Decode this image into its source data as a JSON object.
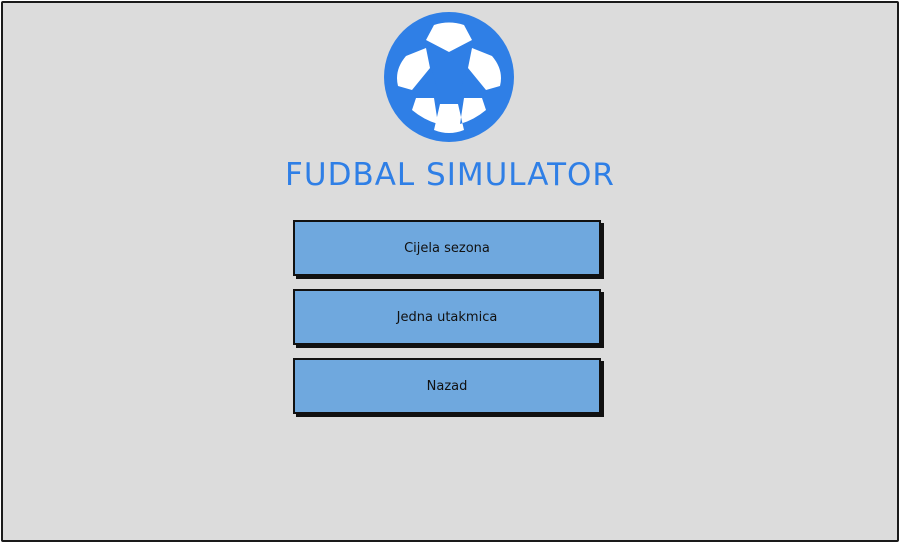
{
  "app": {
    "title": "FUDBAL SIMULATOR"
  },
  "logo": {
    "icon": "soccer-ball-icon",
    "color": "#2f7fe6"
  },
  "menu": {
    "buttons": [
      {
        "label": "Cijela sezona"
      },
      {
        "label": "Jedna utakmica"
      },
      {
        "label": "Nazad"
      }
    ],
    "button_color": "#6fa8de"
  }
}
